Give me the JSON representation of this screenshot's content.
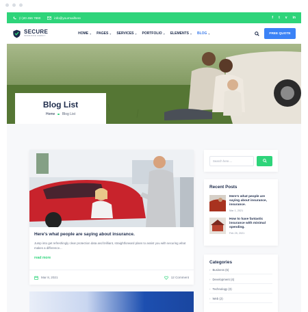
{
  "topbar": {
    "phone": "(+)20 456 7890",
    "email": "info@yourmailhere",
    "social_icons": [
      "facebook-icon",
      "twitter-icon",
      "vimeo-icon",
      "linkedin-icon"
    ],
    "social_glyphs": [
      "f",
      "t",
      "v",
      "in"
    ]
  },
  "brand": {
    "name": "SECURE",
    "tagline": "INSURANCE AGENCY"
  },
  "menu": {
    "items": [
      {
        "label": "HOME"
      },
      {
        "label": "PAGES"
      },
      {
        "label": "SERVICES"
      },
      {
        "label": "PORTFOLIO"
      },
      {
        "label": "ELEMENTS"
      },
      {
        "label": "BLOG"
      }
    ],
    "active": "BLOG",
    "quote_button": "FREE QUOTE"
  },
  "hero": {
    "title": "Blog List",
    "breadcrumb": [
      "Home",
      "Blog List"
    ]
  },
  "post": {
    "title": "Here's what people are saying about insurance.",
    "excerpt": "Jump into get refreshingly clear protection data and brilliant, straightforward plans to assist you with securing what makes a difference...",
    "read_more": "read more",
    "date": "Mar 8, 2021",
    "comments": "12 Comment"
  },
  "sidebar": {
    "search_placeholder": "Search here....",
    "recent_title": "Recent Posts",
    "recent": [
      {
        "title": "Here's what people are saying about insurance, insurance.",
        "date": "Mar 1, 2021"
      },
      {
        "title": "How to have fantastic insurance with minimal spending.",
        "date": "Feb 25, 2021"
      }
    ],
    "categories_title": "Categories",
    "categories": [
      {
        "label": "Business (6)"
      },
      {
        "label": "Development (4)"
      },
      {
        "label": "Technology (3)"
      },
      {
        "label": "Web (2)"
      }
    ]
  },
  "colors": {
    "accent_green": "#2ed47a",
    "accent_blue": "#3b82f6",
    "navy": "#1c2a4a"
  }
}
